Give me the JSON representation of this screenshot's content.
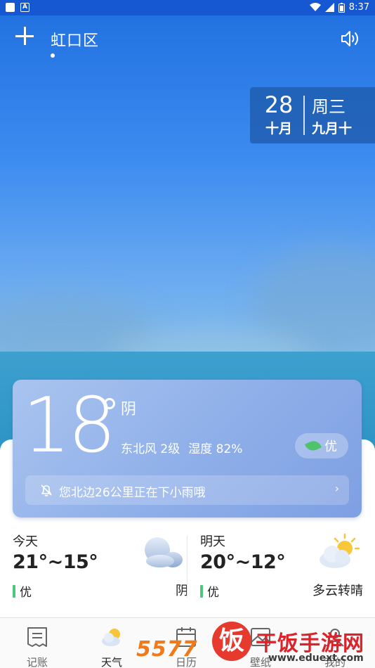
{
  "status_bar": {
    "time": "8:37",
    "icons": [
      "notification-square-icon",
      "a-badge-icon",
      "wifi-icon",
      "signal-icon",
      "battery-icon"
    ]
  },
  "header": {
    "city": "虹口区",
    "icons": [
      "plus-icon",
      "speaker-icon"
    ]
  },
  "date_box": {
    "day": "28",
    "month": "十月",
    "weekday": "周三",
    "lunar": "九月十"
  },
  "current": {
    "temperature": "18",
    "condition": "阴",
    "wind": "东北风 2级",
    "humidity": "湿度 82%",
    "aqi": "优",
    "alert": "您北边26公里正在下小雨哦",
    "alert_chevron": "›"
  },
  "forecast": {
    "today": {
      "label": "今天",
      "range": "21°~15°",
      "aqi": "优",
      "condition": "阴",
      "icon": "cloudy-icon"
    },
    "tomorrow": {
      "label": "明天",
      "range": "20°~12°",
      "aqi": "优",
      "condition": "多云转晴",
      "icon": "partly-sunny-icon"
    }
  },
  "tabs": [
    {
      "label": "记账",
      "icon": "ledger-icon"
    },
    {
      "label": "天气",
      "icon": "weather-icon",
      "active": true
    },
    {
      "label": "日历",
      "icon": "calendar-icon"
    },
    {
      "label": "壁纸",
      "icon": "wallpaper-icon"
    },
    {
      "label": "我的",
      "icon": "profile-icon"
    }
  ],
  "watermark": {
    "number": "5577",
    "char": "饭",
    "brand": "干饭手游网",
    "url": "www.eduext.com"
  },
  "colors": {
    "status_bar": "#1558d2",
    "sky_top": "#1f6fe0",
    "card": "#90b0ea",
    "aqi_green": "#4cc87c",
    "watermark_red": "#d9242b",
    "watermark_orange": "#f07a1a"
  }
}
